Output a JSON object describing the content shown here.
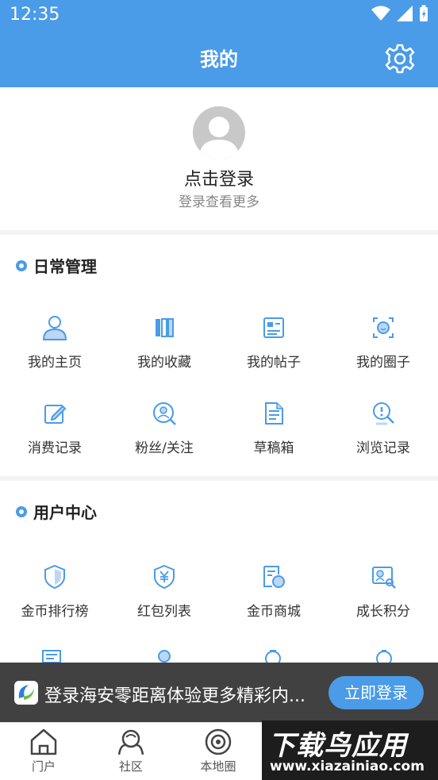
{
  "status_bar": {
    "time": "12:35"
  },
  "header": {
    "title": "我的"
  },
  "profile": {
    "login_title": "点击登录",
    "login_sub": "登录查看更多"
  },
  "daily": {
    "title": "日常管理",
    "items": [
      {
        "label": "我的主页",
        "icon": "user-icon"
      },
      {
        "label": "我的收藏",
        "icon": "books-icon"
      },
      {
        "label": "我的帖子",
        "icon": "post-icon"
      },
      {
        "label": "我的圈子",
        "icon": "circle-icon"
      },
      {
        "label": "消费记录",
        "icon": "edit-icon"
      },
      {
        "label": "粉丝/关注",
        "icon": "fans-icon"
      },
      {
        "label": "草稿箱",
        "icon": "draft-icon"
      },
      {
        "label": "浏览记录",
        "icon": "browse-icon"
      }
    ]
  },
  "user_center": {
    "title": "用户中心",
    "items": [
      {
        "label": "金币排行榜",
        "icon": "shield-icon"
      },
      {
        "label": "红包列表",
        "icon": "yen-shield-icon"
      },
      {
        "label": "金币商城",
        "icon": "store-icon"
      },
      {
        "label": "成长积分",
        "icon": "growth-icon"
      }
    ]
  },
  "banner": {
    "text": "登录海安零距离体验更多精彩内...",
    "button": "立即登录"
  },
  "bottom_nav": [
    {
      "label": "门户",
      "icon": "home-icon"
    },
    {
      "label": "社区",
      "icon": "community-icon"
    },
    {
      "label": "本地圈",
      "icon": "local-circle-icon"
    }
  ],
  "watermark": {
    "main": "下载鸟应用",
    "sub": "www.xiazainiao.com"
  },
  "colors": {
    "primary": "#4a9be8",
    "text": "#222222",
    "muted": "#888888"
  }
}
